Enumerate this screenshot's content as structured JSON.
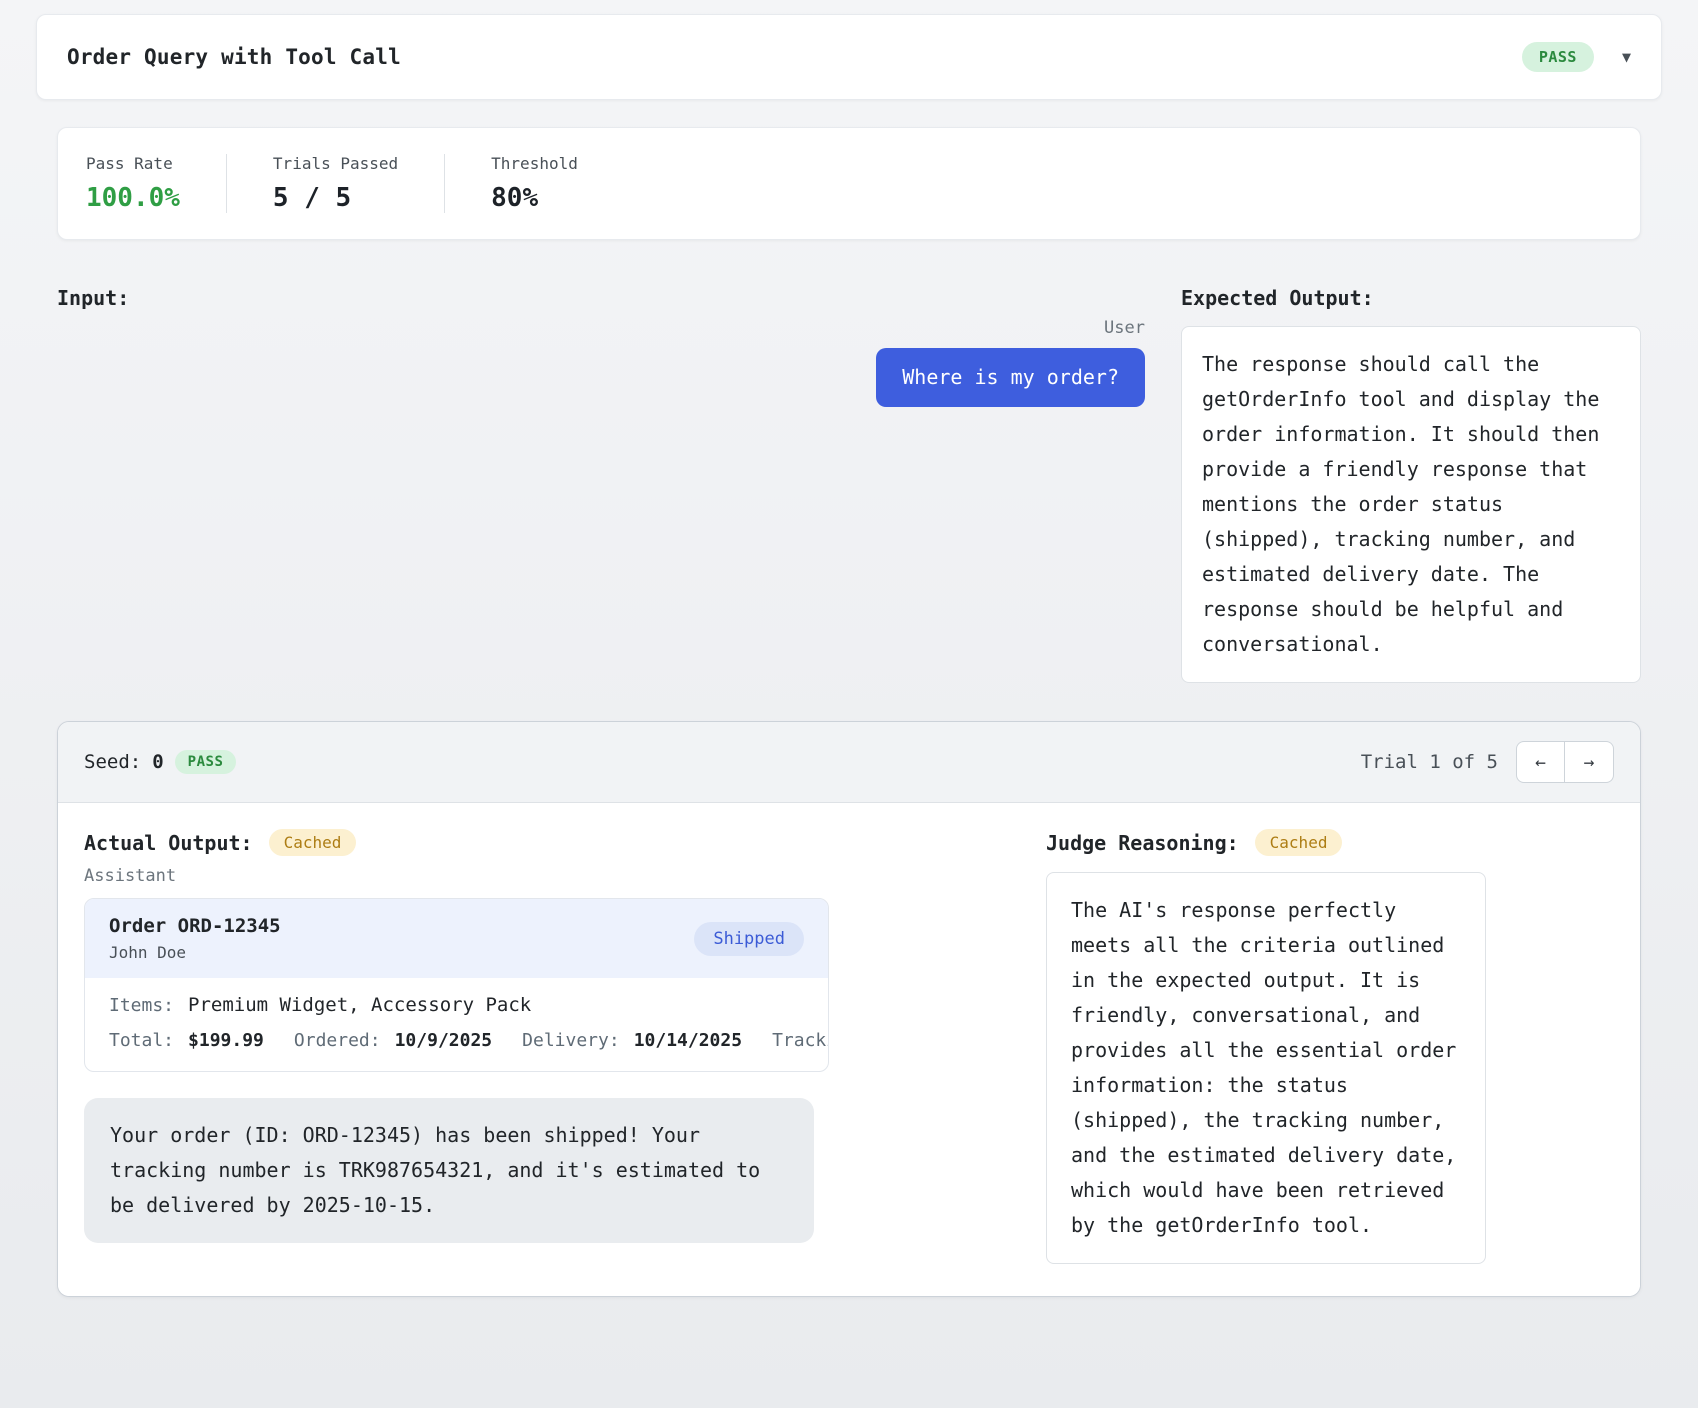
{
  "colors": {
    "pass_text": "#2b8a3e",
    "pass_bg": "#d6f2de",
    "pass_rate_green": "#2f9e44",
    "cached_text": "#ad7d14",
    "cached_bg": "#fcf0d0",
    "user_bubble_bg": "#3e5ede",
    "shipped_text": "#3b5bd6",
    "shipped_bg": "#dbe4f8"
  },
  "header": {
    "title": "Order Query with Tool Call",
    "status_badge": "PASS",
    "collapse_icon": "▼"
  },
  "stats": {
    "items": [
      {
        "label": "Pass Rate",
        "value": "100.0%"
      },
      {
        "label": "Trials Passed",
        "value": "5 / 5"
      },
      {
        "label": "Threshold",
        "value": "80%"
      }
    ]
  },
  "input_section": {
    "heading": "Input:",
    "role": "User",
    "message": "Where is my order?"
  },
  "expected_section": {
    "heading": "Expected Output:",
    "text": "The response should call the getOrderInfo tool and display the order information. It should then provide a friendly response that mentions the order status (shipped), tracking number, and estimated delivery date. The response should be helpful and conversational."
  },
  "trial": {
    "seed_label": "Seed:",
    "seed_value": "0",
    "status_badge": "PASS",
    "pager": {
      "label": "Trial 1 of 5",
      "prev_icon": "←",
      "next_icon": "→"
    },
    "actual": {
      "heading": "Actual Output:",
      "badge": "Cached",
      "role": "Assistant",
      "order": {
        "title": "Order ORD-12345",
        "customer": "John Doe",
        "status": "Shipped",
        "items_label": "Items:",
        "items_value": "Premium Widget, Accessory Pack",
        "total_label": "Total:",
        "total_value": "$199.99",
        "ordered_label": "Ordered:",
        "ordered_value": "10/9/2025",
        "delivery_label": "Delivery:",
        "delivery_value": "10/14/2025",
        "tracking_label": "Tracking:"
      },
      "message": "Your order (ID: ORD-12345) has been shipped! Your tracking number is TRK987654321, and it's estimated to be delivered by 2025-10-15."
    },
    "judge": {
      "heading": "Judge Reasoning:",
      "badge": "Cached",
      "text": "The AI's response perfectly meets all the criteria outlined in the expected output. It is friendly, conversational, and provides all the essential order information: the status (shipped), the tracking number, and the estimated delivery date, which would have been retrieved by the getOrderInfo tool."
    }
  }
}
